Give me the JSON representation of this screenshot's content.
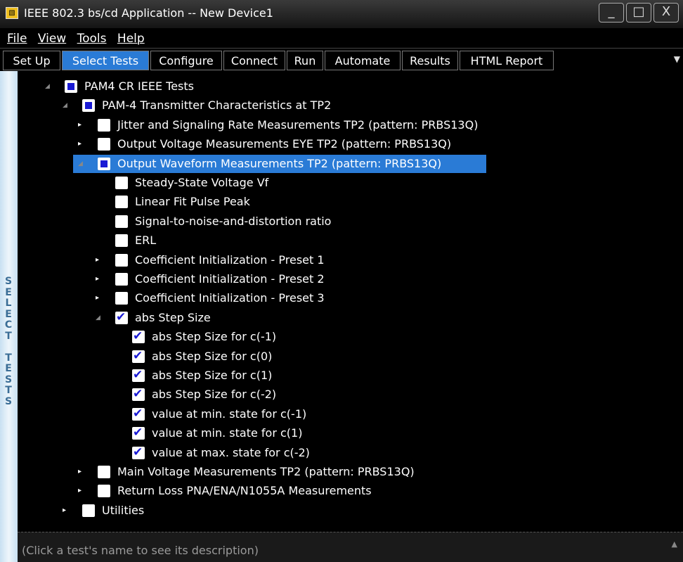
{
  "window": {
    "title": "IEEE 802.3 bs/cd Application -- New Device1",
    "app_icon": "app-icon-glyph",
    "buttons": [
      "_",
      "□",
      "X"
    ]
  },
  "menu": {
    "file": "File",
    "view": "View",
    "tools": "Tools",
    "help": "Help"
  },
  "tabs": [
    "Set Up",
    "Select Tests",
    "Configure",
    "Connect",
    "Run",
    "Automate",
    "Results",
    "HTML Report"
  ],
  "active_tab": "Select Tests",
  "sidebar": {
    "label": "SELECT TESTS"
  },
  "tree": [
    {
      "label": "PAM4 CR IEEE Tests",
      "level": 0,
      "state": "partial",
      "expander": "expanded"
    },
    {
      "label": "PAM-4 Transmitter Characteristics at TP2",
      "level": 1,
      "state": "partial",
      "expander": "expanded"
    },
    {
      "label": "Jitter and Signaling Rate Measurements TP2 (pattern: PRBS13Q)",
      "level": 2,
      "state": "unchecked",
      "expander": "collapsed"
    },
    {
      "label": "Output Voltage Measurements EYE TP2 (pattern: PRBS13Q)",
      "level": 2,
      "state": "unchecked",
      "expander": "collapsed"
    },
    {
      "label": "Output Waveform Measurements TP2 (pattern: PRBS13Q)",
      "level": 2,
      "state": "partial",
      "expander": "expanded",
      "selected": true
    },
    {
      "label": "Steady-State Voltage Vf",
      "level": 3,
      "state": "unchecked",
      "expander": "none"
    },
    {
      "label": "Linear Fit Pulse Peak",
      "level": 3,
      "state": "unchecked",
      "expander": "none"
    },
    {
      "label": "Signal-to-noise-and-distortion ratio",
      "level": 3,
      "state": "unchecked",
      "expander": "none"
    },
    {
      "label": "ERL",
      "level": 3,
      "state": "unchecked",
      "expander": "none"
    },
    {
      "label": "Coefficient Initialization - Preset 1",
      "level": 3,
      "state": "unchecked",
      "expander": "collapsed"
    },
    {
      "label": "Coefficient Initialization - Preset 2",
      "level": 3,
      "state": "unchecked",
      "expander": "collapsed"
    },
    {
      "label": "Coefficient Initialization - Preset 3",
      "level": 3,
      "state": "unchecked",
      "expander": "collapsed"
    },
    {
      "label": "abs Step Size",
      "level": 3,
      "state": "checked",
      "expander": "expanded"
    },
    {
      "label": "abs Step Size for c(-1)",
      "level": 4,
      "state": "checked",
      "expander": "none"
    },
    {
      "label": "abs Step Size for c(0)",
      "level": 4,
      "state": "checked",
      "expander": "none"
    },
    {
      "label": "abs Step Size for c(1)",
      "level": 4,
      "state": "checked",
      "expander": "none"
    },
    {
      "label": "abs Step Size for c(-2)",
      "level": 4,
      "state": "checked",
      "expander": "none"
    },
    {
      "label": "value at min. state for c(-1)",
      "level": 4,
      "state": "checked",
      "expander": "none"
    },
    {
      "label": "value at min. state for c(1)",
      "level": 4,
      "state": "checked",
      "expander": "none"
    },
    {
      "label": "value at max. state for c(-2)",
      "level": 4,
      "state": "checked",
      "expander": "none"
    },
    {
      "label": "Main Voltage Measurements TP2 (pattern: PRBS13Q)",
      "level": 2,
      "state": "unchecked",
      "expander": "collapsed"
    },
    {
      "label": "Return Loss PNA/ENA/N1055A Measurements",
      "level": 2,
      "state": "unchecked",
      "expander": "collapsed"
    },
    {
      "label": "Utilities",
      "level": 1,
      "state": "unchecked",
      "expander": "collapsed"
    }
  ],
  "status": {
    "text": "(Click a test's name to see its description)"
  },
  "colors": {
    "accent": "#2a7bd6",
    "check": "#1a1ad4",
    "background": "#000000",
    "sidebar": "#c8e0f2"
  }
}
